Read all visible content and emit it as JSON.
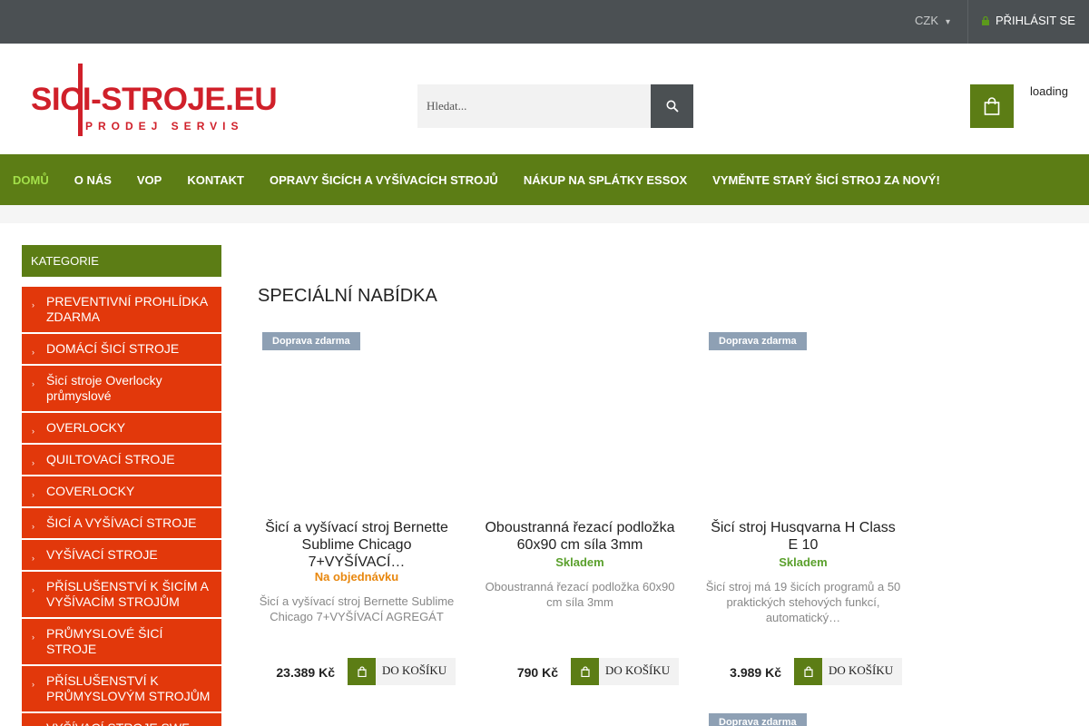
{
  "topbar": {
    "currency": "CZK",
    "login": "PŘIHLÁSIT SE"
  },
  "header": {
    "logo_text": "SICI-STROJE.EU",
    "logo_tagline": "PRODEJ SERVIS",
    "search_placeholder": "Hledat...",
    "cart_status": "loading"
  },
  "nav": [
    {
      "label": "DOMŮ",
      "active": true
    },
    {
      "label": "O NÁS"
    },
    {
      "label": "VOP"
    },
    {
      "label": "KONTAKT"
    },
    {
      "label": "OPRAVY ŠICÍCH A VYŠÍVACÍCH STROJŮ"
    },
    {
      "label": "NÁKUP NA SPLÁTKY ESSOX"
    },
    {
      "label": "VYMĚNTE STARÝ ŠICÍ STROJ ZA NOVÝ!"
    }
  ],
  "sidebar": {
    "title": "KATEGORIE",
    "items": [
      "PREVENTIVNÍ PROHLÍDKA ZDARMA",
      "DOMÁCÍ ŠICÍ STROJE",
      "Šicí stroje Overlocky průmyslové",
      "OVERLOCKY",
      "QUILTOVACÍ STROJE",
      "COVERLOCKY",
      "ŠICÍ A VYŠÍVACÍ STROJE",
      "VYŠÍVACÍ STROJE",
      "PŘÍSLUŠENSTVÍ K ŠICÍM A VYŠÍVACÍM STROJŮM",
      "PRŮMYSLOVÉ ŠICÍ STROJE",
      "PŘÍSLUŠENSTVÍ K PRŮMYSLOVÝM STROJŮM",
      "VYŠÍVACÍ STROJE SWF"
    ]
  },
  "main": {
    "title": "SPECIÁLNÍ NABÍDKA",
    "add_label": "DO KOŠÍKU",
    "products": [
      {
        "badge": "Doprava zdarma",
        "name": "Šicí a vyšívací stroj Bernette Sublime Chicago 7+VYŠÍVACÍ…",
        "availability": "Na objednávku",
        "availability_color": "#e8870e",
        "description": "Šicí a vyšívací stroj Bernette Sublime Chicago 7+VYŠÍVACÍ AGREGÁT",
        "price": "23.389 Kč"
      },
      {
        "badge": "",
        "name": "Oboustranná řezací podložka 60x90 cm síla 3mm",
        "availability": "Skladem",
        "availability_color": "#5aa02c",
        "description": "Oboustranná řezací podložka 60x90 cm síla 3mm",
        "price": "790 Kč"
      },
      {
        "badge": "Doprava zdarma",
        "name": "Šicí stroj Husqvarna H Class E 10",
        "availability": "Skladem",
        "availability_color": "#5aa02c",
        "description": "Šicí stroj má 19 šicích programů a 50 praktických stehových funkcí, automatický…",
        "price": "3.989 Kč"
      }
    ],
    "next_badge": "Doprava zdarma"
  },
  "colors": {
    "green": "#5c7d15",
    "orange_red": "#e2380b",
    "dark": "#4b5053",
    "logo_red": "#d0202a"
  }
}
